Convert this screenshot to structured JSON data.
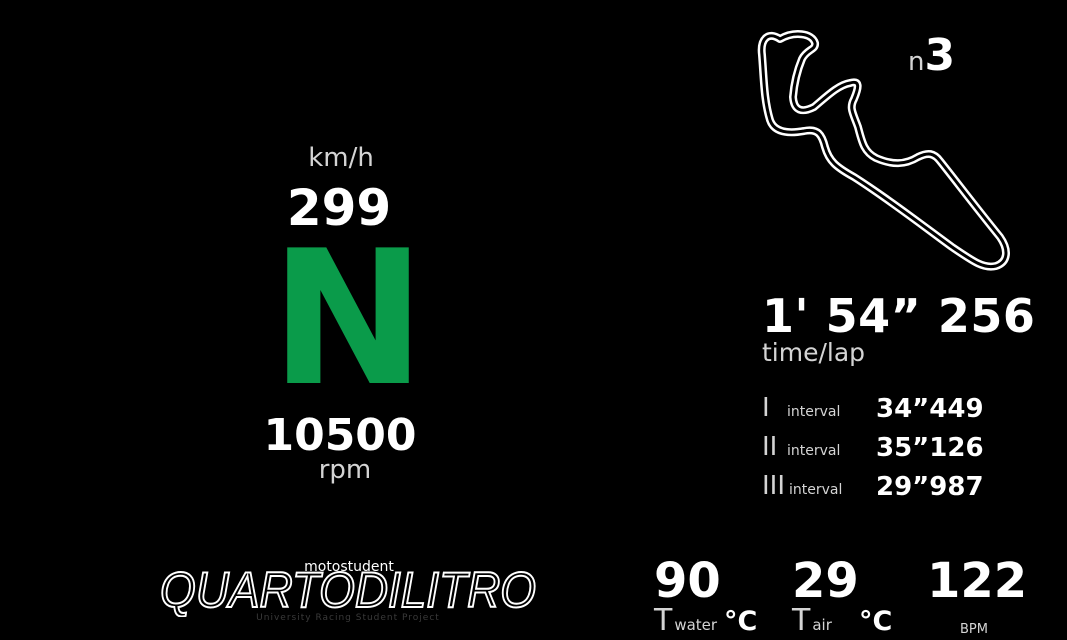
{
  "speed": {
    "unit": "km/h",
    "value": "299"
  },
  "gear": {
    "value": "N",
    "color": "#0a9b4a"
  },
  "rpm": {
    "value": "10500",
    "unit": "rpm"
  },
  "lap": {
    "prefix": "n",
    "number": "3"
  },
  "laptime": {
    "value": "1' 54” 256",
    "label": "time/lap"
  },
  "intervals": [
    {
      "roman": "I",
      "word": "interval",
      "time": "34”449"
    },
    {
      "roman": "II",
      "word": "interval",
      "time": "35”126"
    },
    {
      "roman": "III",
      "word": "interval",
      "time": "29”987"
    }
  ],
  "logo": {
    "top_text": "motostudent",
    "main_text": "QUARTODILITRO",
    "sub_text": "University Racing Student Project"
  },
  "stats": {
    "water": {
      "value": "90",
      "symbol": "T",
      "sub": "water",
      "unit": "°C"
    },
    "air": {
      "value": "29",
      "symbol": "T",
      "sub": "air",
      "unit": "°C"
    },
    "heart": {
      "value": "122",
      "unit": "BPM"
    }
  }
}
